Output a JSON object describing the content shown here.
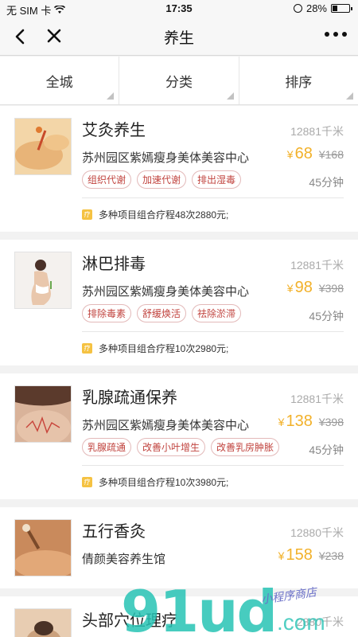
{
  "status_bar": {
    "carrier": "无 SIM 卡",
    "time": "17:35",
    "battery": "28%",
    "battery_level": 0.28
  },
  "nav": {
    "title": "养生",
    "back_icon": "chevron-left-icon",
    "close_icon": "close-icon",
    "more_icon": "more-dots-icon"
  },
  "filters": [
    {
      "label": "全城"
    },
    {
      "label": "分类"
    },
    {
      "label": "排序"
    }
  ],
  "items": [
    {
      "name": "艾灸养生",
      "distance": "12881千米",
      "shop": "苏州园区紫嫣瘦身美体美容中心",
      "price_symbol": "¥",
      "price": "68",
      "original_price": "¥168",
      "tags": [
        "组织代谢",
        "加速代谢",
        "排出湿毒"
      ],
      "duration": "45分钟",
      "promo": "多种项目组合疗程48次2880元;",
      "promo_badge": "疗"
    },
    {
      "name": "淋巴排毒",
      "distance": "12881千米",
      "shop": "苏州园区紫嫣瘦身美体美容中心",
      "price_symbol": "¥",
      "price": "98",
      "original_price": "¥398",
      "tags": [
        "排除毒素",
        "舒缓焕活",
        "祛除淤滞"
      ],
      "duration": "45分钟",
      "promo": "多种项目组合疗程10次2980元;",
      "promo_badge": "疗"
    },
    {
      "name": "乳腺疏通保养",
      "distance": "12881千米",
      "shop": "苏州园区紫嫣瘦身美体美容中心",
      "price_symbol": "¥",
      "price": "138",
      "original_price": "¥398",
      "tags": [
        "乳腺疏通",
        "改善小叶增生",
        "改善乳房肿胀"
      ],
      "duration": "45分钟",
      "promo": "多种项目组合疗程10次3980元;",
      "promo_badge": "疗"
    },
    {
      "name": "五行香灸",
      "distance": "12880千米",
      "shop": "倩颜美容养生馆",
      "price_symbol": "¥",
      "price": "158",
      "original_price": "¥238"
    },
    {
      "name": "头部穴位理疗",
      "distance": "2880千米"
    }
  ],
  "watermark": {
    "main": "91ud",
    "tagline": "小程序商店",
    "domain": ".com"
  },
  "colors": {
    "price": "#f2b12a",
    "tag_text": "#c1443f",
    "tag_border": "#e3b9b9",
    "promo_badge": "#f5c242"
  }
}
